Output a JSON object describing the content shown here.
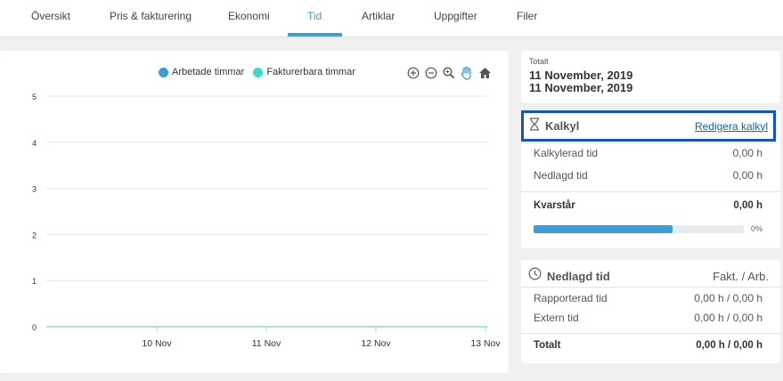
{
  "nav": {
    "tabs": [
      {
        "label": "Översikt"
      },
      {
        "label": "Pris & fakturering"
      },
      {
        "label": "Ekonomi"
      },
      {
        "label": "Tid"
      },
      {
        "label": "Artiklar"
      },
      {
        "label": "Uppgifter"
      },
      {
        "label": "Filer"
      }
    ],
    "active_tab": "Tid",
    "accent_color": "#3d9dd6"
  },
  "chart": {
    "legend": [
      "Arbetade timmar",
      "Fakturerbara timmar"
    ],
    "tools": [
      "zoom-in-icon",
      "zoom-out-icon",
      "magnifier-icon",
      "pan-hand-icon",
      "home-icon"
    ]
  },
  "chart_data": {
    "type": "line",
    "title": "",
    "xlabel": "",
    "ylabel": "",
    "categories": [
      "10 Nov",
      "11 Nov",
      "12 Nov",
      "13 Nov"
    ],
    "yticks": [
      "0",
      "1",
      "2",
      "3",
      "4",
      "5"
    ],
    "ylim": [
      0,
      5
    ],
    "grid": true,
    "legend_position": "top-center",
    "series": [
      {
        "name": "Arbetade timmar",
        "color": "#3d9dd6",
        "values": [
          0,
          0,
          0,
          0
        ]
      },
      {
        "name": "Fakturerbara timmar",
        "color": "#3ddbc4",
        "values": [
          0,
          0,
          0,
          0
        ]
      }
    ]
  },
  "total": {
    "label": "Totalt",
    "date1": "11 November, 2019",
    "date2": "11 November, 2019"
  },
  "kalkyl": {
    "icon": "hourglass-icon",
    "title": "Kalkyl",
    "edit_link": "Redigera kalkyl",
    "rows": [
      {
        "label": "Kalkylerad tid",
        "value": "0,00 h"
      },
      {
        "label": "Nedlagd tid",
        "value": "0,00 h"
      }
    ],
    "remaining_label": "Kvarstår",
    "remaining_value": "0,00 h",
    "progress_fraction": 0.66,
    "progress_text": "0%",
    "highlight_color": "#1553c1"
  },
  "nedlagd": {
    "icon": "clock-icon",
    "title": "Nedlagd tid",
    "columns": "Fakt. / Arb.",
    "rows": [
      {
        "label": "Rapporterad tid",
        "value": "0,00 h / 0,00 h"
      },
      {
        "label": "Extern tid",
        "value": "0,00 h / 0,00 h"
      }
    ],
    "total_label": "Totalt",
    "total_value": "0,00 h / 0,00 h"
  }
}
